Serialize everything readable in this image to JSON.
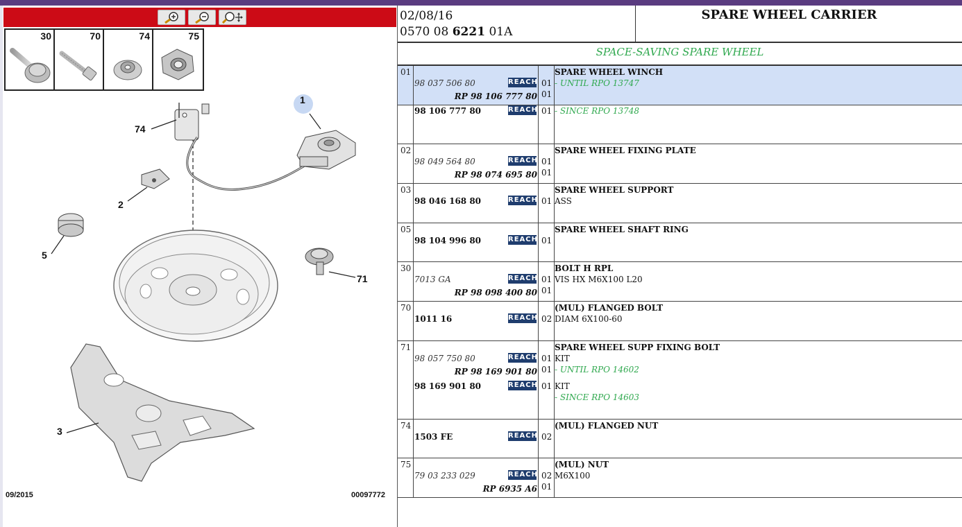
{
  "toolbar": {
    "zoom_in_icon": "magnifier-plus-icon",
    "zoom_out_icon": "magnifier-minus-icon",
    "pan_icon": "magnifier-move-icon",
    "bar_color": "#cc0b16"
  },
  "thumbnails": [
    {
      "num": "30",
      "icon": "flanged-bolt-icon"
    },
    {
      "num": "70",
      "icon": "bolt-icon"
    },
    {
      "num": "74",
      "icon": "flanged-nut-icon"
    },
    {
      "num": "75",
      "icon": "nut-icon"
    }
  ],
  "diagram": {
    "callouts": [
      "1",
      "74",
      "2",
      "5",
      "71",
      "3"
    ],
    "date": "09/2015",
    "ref": "00097772"
  },
  "header": {
    "date": "02/08/16",
    "code_a": "0570 08",
    "code_b": "6221",
    "code_c": "01A",
    "title": "SPARE WHEEL CARRIER"
  },
  "variant": "SPACE-SAVING SPARE WHEEL",
  "reach_label": "REACH",
  "rows": [
    {
      "ref": "01",
      "pn1": "98 037 506 80",
      "rp": "RP 98 106 777 80",
      "q1": "01",
      "q2": "01",
      "title": "SPARE WHEEL WINCH",
      "note1": "- UNTIL RPO 13747",
      "pn2": "98 106 777 80",
      "q3": "01",
      "note2": "- SINCE RPO 13748"
    },
    {
      "ref": "02",
      "pn1": "98 049 564 80",
      "rp": "RP 98 074 695 80",
      "q1": "01",
      "q2": "01",
      "title": "SPARE WHEEL FIXING PLATE"
    },
    {
      "ref": "03",
      "pn1": "98 046 168 80",
      "q1": "01",
      "title": "SPARE WHEEL SUPPORT",
      "line2": "ASS"
    },
    {
      "ref": "05",
      "pn1": "98 104 996 80",
      "q1": "01",
      "title": "SPARE WHEEL SHAFT RING"
    },
    {
      "ref": "30",
      "pn1": "7013 GA",
      "rp": "RP 98 098 400 80",
      "q1": "01",
      "q2": "01",
      "title": "BOLT H RPL",
      "line2": "VIS HX M6X100 L20"
    },
    {
      "ref": "70",
      "pn1": "1011 16",
      "q1": "02",
      "title": "(MUL) FLANGED BOLT",
      "line2": "DIAM 6X100-60"
    },
    {
      "ref": "71",
      "pn1": "98 057 750 80",
      "rp": "RP 98 169 901 80",
      "q1": "01",
      "q2": "01",
      "title": "SPARE WHEEL SUPP FIXING BOLT",
      "line2": "KIT",
      "note1": "- UNTIL RPO 14602",
      "pn2": "98 169 901 80",
      "q3": "01",
      "line3": "KIT",
      "note2": "- SINCE RPO 14603"
    },
    {
      "ref": "74",
      "pn1": "1503 FE",
      "q1": "02",
      "title": "(MUL) FLANGED NUT"
    },
    {
      "ref": "75",
      "pn1": "79 03 233 029",
      "rp": "RP 6935 A6",
      "q1": "02",
      "q2": "01",
      "title": "(MUL) NUT",
      "line2": "M6X100"
    }
  ]
}
